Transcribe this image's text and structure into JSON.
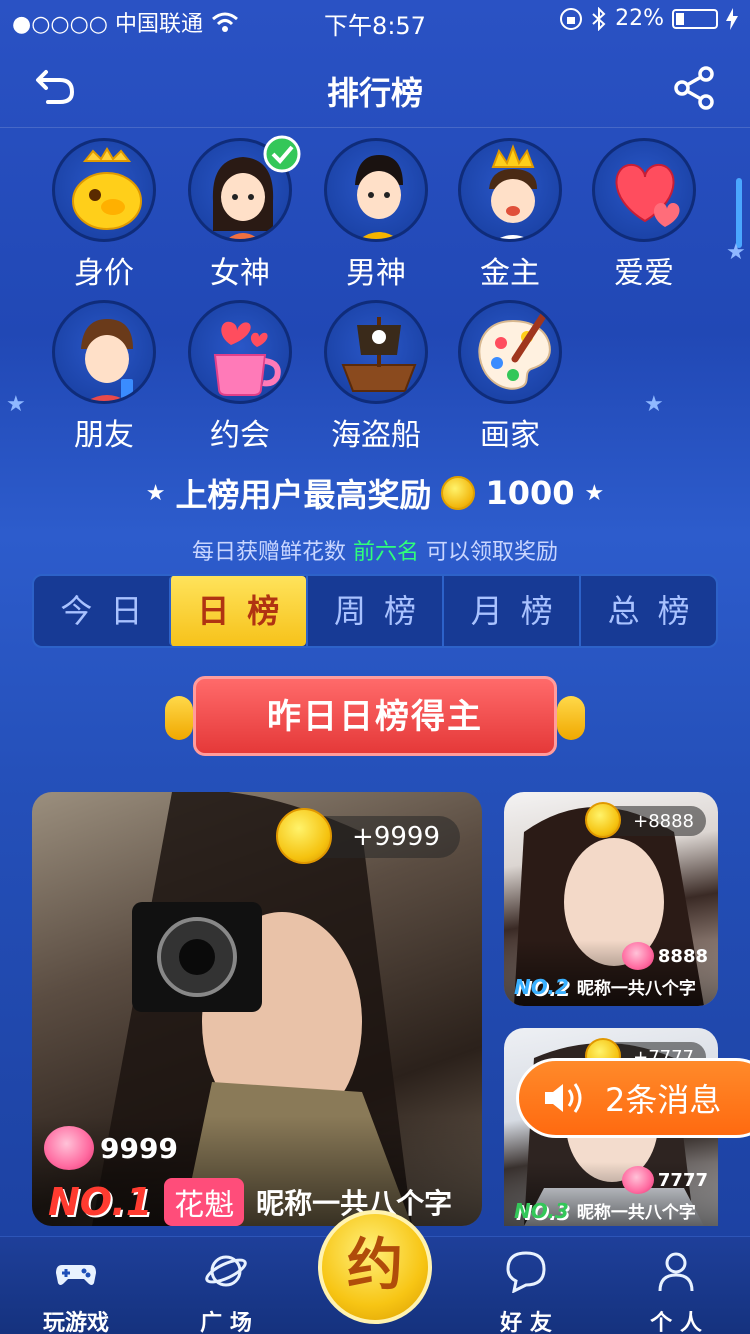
{
  "status_bar": {
    "carrier": "●○○○○ 中国联通",
    "time": "下午8:57",
    "battery": "22%",
    "battery_level": 0.22
  },
  "nav": {
    "title": "排行榜"
  },
  "categories": [
    {
      "label": "身价",
      "icon": "golden-pig-icon"
    },
    {
      "label": "女神",
      "icon": "goddess-icon"
    },
    {
      "label": "男神",
      "icon": "male-god-icon"
    },
    {
      "label": "金主",
      "icon": "crowned-boy-icon"
    },
    {
      "label": "爱爱",
      "icon": "hearts-icon"
    },
    {
      "label": "朋友",
      "icon": "friend-icon"
    },
    {
      "label": "约会",
      "icon": "love-cup-icon"
    },
    {
      "label": "海盗船",
      "icon": "pirate-ship-icon"
    },
    {
      "label": "画家",
      "icon": "palette-icon"
    }
  ],
  "reward": {
    "title": "上榜用户最高奖励",
    "amount": "1000",
    "note_prefix": "每日获赠鲜花数",
    "note_highlight": "前六名",
    "note_suffix": "可以领取奖励"
  },
  "tabs": [
    "今日",
    "日榜",
    "周榜",
    "月榜",
    "总榜"
  ],
  "active_tab": "日榜",
  "banner": "昨日日榜得主",
  "winners": [
    {
      "coins": "+9999",
      "flowers": "9999",
      "rank": "NO.1",
      "badge": "花魁",
      "nickname": "昵称一共八个字"
    },
    {
      "coins": "+8888",
      "flowers": "8888",
      "rank": "NO.2",
      "nickname": "昵称一共八个字"
    },
    {
      "coins": "+7777",
      "flowers": "7777",
      "rank": "NO.3",
      "nickname": "昵称一共八个字"
    }
  ],
  "toast": "2条消息",
  "tabbar": [
    {
      "label": "玩游戏",
      "icon": "gamepad-icon"
    },
    {
      "label": "广 场",
      "icon": "planet-icon"
    },
    {
      "label": "约",
      "icon": "yue-button"
    },
    {
      "label": "好 友",
      "icon": "chat-bubble-icon"
    },
    {
      "label": "个 人",
      "icon": "person-icon"
    }
  ]
}
